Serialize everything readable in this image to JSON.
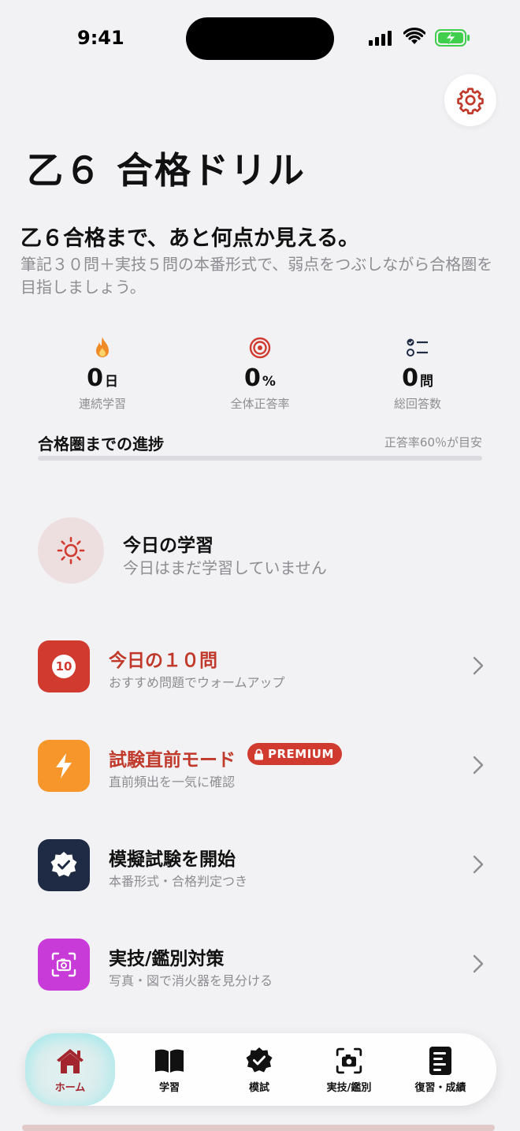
{
  "status_bar": {
    "time": "9:41"
  },
  "header": {
    "app_title": "乙６ 合格ドリル",
    "settings_icon": "gear-icon"
  },
  "hero": {
    "headline": "乙６合格まで、あと何点か見える。",
    "subtext": "筆記３０問＋実技５問の本番形式で、弱点をつぶしながら合格圏を目指しましょう。"
  },
  "stats": [
    {
      "icon": "flame-icon",
      "value": "0",
      "unit": "日",
      "label": "連続学習"
    },
    {
      "icon": "target-icon",
      "value": "0",
      "unit": "%",
      "label": "全体正答率"
    },
    {
      "icon": "checklist-icon",
      "value": "0",
      "unit": "問",
      "label": "総回答数"
    }
  ],
  "progress": {
    "title": "合格圏までの進捗",
    "hint": "正答率60％が目安",
    "percent": 0
  },
  "today": {
    "title": "今日の学習",
    "subtitle": "今日はまだ学習していません",
    "icon": "sun-icon"
  },
  "menu": [
    {
      "title": "今日の１０問",
      "subtitle": "おすすめ問題でウォームアップ",
      "icon_text": "10",
      "color": "#d03a2f"
    },
    {
      "title": "試験直前モード",
      "subtitle": "直前頻出を一気に確認",
      "badge": "PREMIUM",
      "color": "#f7962b"
    },
    {
      "title": "模擬試験を開始",
      "subtitle": "本番形式・合格判定つき",
      "color": "#1f2a44"
    },
    {
      "title": "実技/鑑別対策",
      "subtitle": "写真・図で消火器を見分ける",
      "color": "#c93bd8"
    }
  ],
  "tabs": [
    {
      "label": "ホーム",
      "icon": "home-icon",
      "active": true
    },
    {
      "label": "学習",
      "icon": "book-icon"
    },
    {
      "label": "模試",
      "icon": "badge-check-icon"
    },
    {
      "label": "実技/鑑別",
      "icon": "camera-icon"
    },
    {
      "label": "復習・成績",
      "icon": "document-icon"
    }
  ],
  "colors": {
    "accent": "#d03a2f",
    "background": "#f2f2f4"
  }
}
